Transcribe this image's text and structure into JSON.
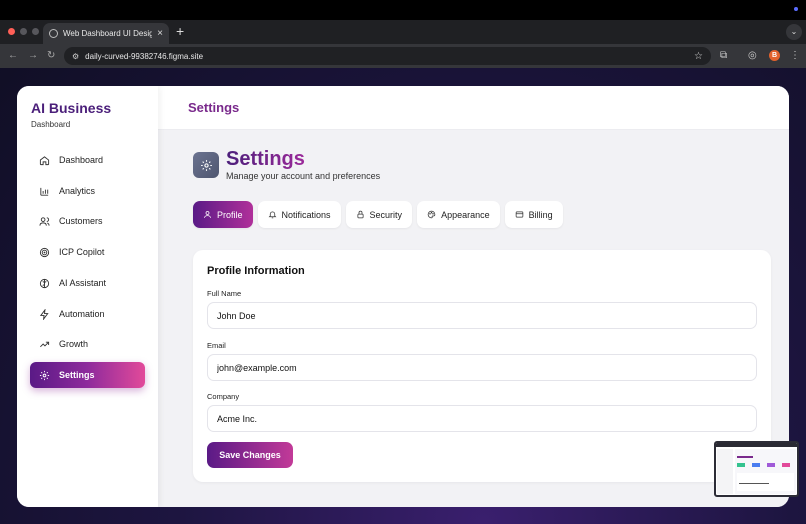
{
  "browser": {
    "tab_title": "Web Dashboard UI Design",
    "tab_close": "×",
    "new_tab": "+",
    "url": "daily-curved-99382746.figma.site",
    "profile_initial": "B",
    "traffic_colors": [
      "#ff5f57",
      "#57575c",
      "#57575c"
    ]
  },
  "sidebar": {
    "brand": "AI Business",
    "subtitle": "Dashboard",
    "items": [
      {
        "label": "Dashboard",
        "icon": "home-icon"
      },
      {
        "label": "Analytics",
        "icon": "bar-chart-icon"
      },
      {
        "label": "Customers",
        "icon": "users-icon"
      },
      {
        "label": "ICP Copilot",
        "icon": "target-icon"
      },
      {
        "label": "AI Assistant",
        "icon": "brain-icon"
      },
      {
        "label": "Automation",
        "icon": "zap-icon"
      },
      {
        "label": "Growth",
        "icon": "trending-up-icon"
      },
      {
        "label": "Settings",
        "icon": "gear-icon",
        "active": true
      }
    ]
  },
  "header": {
    "title": "Settings"
  },
  "page": {
    "title": "Settings",
    "subtitle": "Manage your account and preferences",
    "tabs": [
      {
        "label": "Profile",
        "icon": "user-icon",
        "active": true
      },
      {
        "label": "Notifications",
        "icon": "bell-icon"
      },
      {
        "label": "Security",
        "icon": "lock-icon"
      },
      {
        "label": "Appearance",
        "icon": "palette-icon"
      },
      {
        "label": "Billing",
        "icon": "credit-card-icon"
      }
    ]
  },
  "profile": {
    "title": "Profile Information",
    "fields": [
      {
        "label": "Full Name",
        "value": "John Doe"
      },
      {
        "label": "Email",
        "value": "john@example.com"
      },
      {
        "label": "Company",
        "value": "Acme Inc."
      }
    ],
    "save_label": "Save Changes"
  },
  "colors": {
    "accent_start": "#5a1a86",
    "accent_end": "#e24a9a",
    "brand_text": "#4b1f7a"
  }
}
